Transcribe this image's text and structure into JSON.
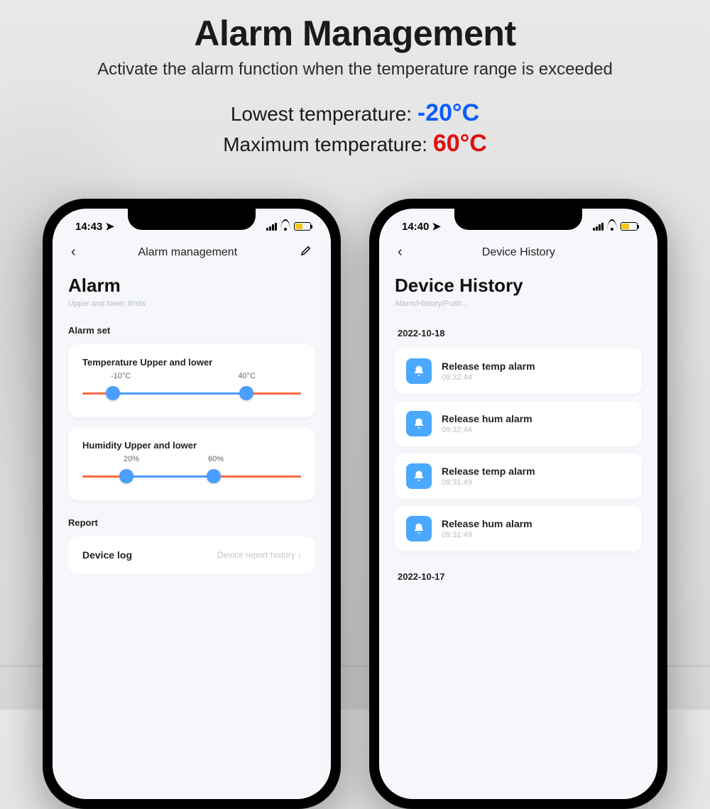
{
  "hero": {
    "title": "Alarm Management",
    "subtitle": "Activate the alarm function when the temperature range is exceeded"
  },
  "stats": {
    "low_label": "Lowest temperature: ",
    "low_value": "-20°C",
    "max_label": "Maximum temperature: ",
    "max_value": "60°C"
  },
  "phone_left": {
    "status_time": "14:43",
    "nav_title": "Alarm management",
    "section_title": "Alarm",
    "section_sub": "Upper and lower limits",
    "alarm_set_label": "Alarm set",
    "temp_card_title": "Temperature Upper and lower",
    "temp_low": "-10°C",
    "temp_high": "40°C",
    "hum_card_title": "Humidity Upper and lower",
    "hum_low": "20%",
    "hum_high": "60%",
    "report_label": "Report",
    "device_log": "Device log",
    "device_report_history": "Device report history"
  },
  "phone_right": {
    "status_time": "14:40",
    "nav_title": "Device History",
    "section_title": "Device History",
    "section_sub": "Alarm/History/Push...",
    "dates": [
      {
        "date": "2022-10-18",
        "items": [
          {
            "title": "Release temp alarm",
            "time": "09:32:44"
          },
          {
            "title": "Release hum alarm",
            "time": "09:32:44"
          },
          {
            "title": "Release temp alarm",
            "time": "09:31:49"
          },
          {
            "title": "Release hum alarm",
            "time": "09:31:49"
          }
        ]
      },
      {
        "date": "2022-10-17",
        "items": []
      }
    ]
  }
}
